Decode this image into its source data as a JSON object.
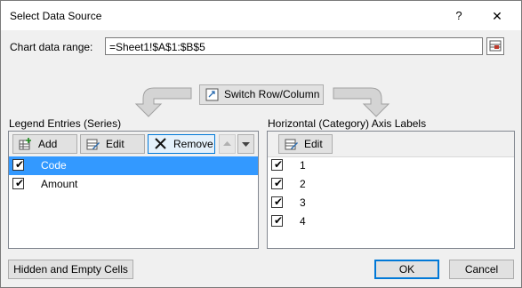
{
  "window": {
    "title": "Select Data Source",
    "help": "?",
    "close": "✕"
  },
  "range": {
    "label": "Chart data range:",
    "value": "=Sheet1!$A$1:$B$5"
  },
  "switch_button": "Switch Row/Column",
  "legend": {
    "title": "Legend Entries (Series)",
    "toolbar": {
      "add": "Add",
      "edit": "Edit",
      "remove": "Remove"
    },
    "items": [
      {
        "label": "Code",
        "checked": true,
        "selected": true
      },
      {
        "label": "Amount",
        "checked": true,
        "selected": false
      }
    ]
  },
  "axis": {
    "title": "Horizontal (Category) Axis Labels",
    "toolbar": {
      "edit": "Edit"
    },
    "items": [
      {
        "label": "1",
        "checked": true
      },
      {
        "label": "2",
        "checked": true
      },
      {
        "label": "3",
        "checked": true
      },
      {
        "label": "4",
        "checked": true
      }
    ]
  },
  "footer": {
    "hidden": "Hidden and Empty Cells",
    "ok": "OK",
    "cancel": "Cancel"
  },
  "colors": {
    "selection": "#3399ff",
    "focus": "#0078d7"
  }
}
